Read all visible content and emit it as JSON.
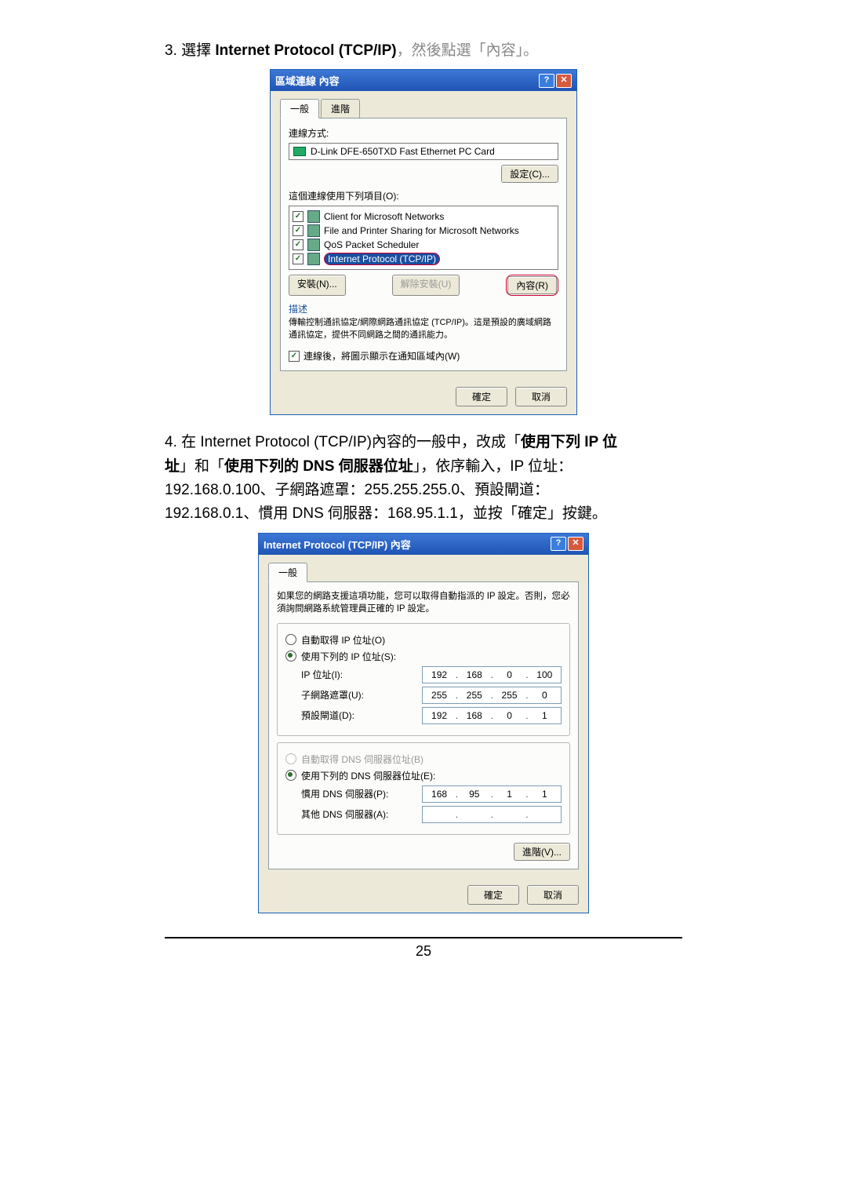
{
  "step3": {
    "prefix": "3. 選擇 ",
    "bold": "Internet Protocol (TCP/IP)",
    "suffix_gray": "，然後點選「內容」。"
  },
  "dlg1": {
    "title": "區域連線 內容",
    "tab_general": "一般",
    "tab_advanced": "進階",
    "conn_method_label": "連線方式:",
    "adapter": "D-Link DFE-650TXD Fast Ethernet PC Card",
    "configure_btn": "設定(C)...",
    "uses_items_label": "這個連線使用下列項目(O):",
    "items": [
      "Client for Microsoft Networks",
      "File and Printer Sharing for Microsoft Networks",
      "QoS Packet Scheduler",
      "Internet Protocol (TCP/IP)"
    ],
    "install_btn": "安裝(N)...",
    "uninstall_btn": "解除安裝(U)",
    "properties_btn": "內容(R)",
    "desc_title": "描述",
    "desc_text": "傳輸控制通訊協定/網際網路通訊協定 (TCP/IP)。這是預設的廣域網路通訊協定，提供不同網路之間的通訊能力。",
    "show_icon": "連線後，將圖示顯示在通知區域內(W)",
    "ok": "確定",
    "cancel": "取消"
  },
  "step4": {
    "line1_prefix": "4. 在 Internet Protocol (TCP/IP)內容的一般中，改成「",
    "line1_bold1": "使用下列 IP 位",
    "line2_bold_cont": "址",
    "line2_mid": "」和「",
    "line2_bold2": "使用下列的 DNS 伺服器位址",
    "line2_suffix": "」，依序輸入，IP 位址：",
    "line3": "192.168.0.100、子網路遮罩：255.255.255.0、預設閘道：",
    "line4": "192.168.0.1、慣用 DNS 伺服器：168.95.1.1，並按「確定」按鍵。"
  },
  "dlg2": {
    "title": "Internet Protocol (TCP/IP) 內容",
    "tab_general": "一般",
    "note": "如果您的網路支援這項功能，您可以取得自動指派的 IP 設定。否則，您必須詢問網路系統管理員正確的 IP 設定。",
    "auto_ip": "自動取得 IP 位址(O)",
    "use_ip": "使用下列的 IP 位址(S):",
    "ip_label": "IP 位址(I):",
    "ip_value": [
      "192",
      "168",
      "0",
      "100"
    ],
    "mask_label": "子網路遮罩(U):",
    "mask_value": [
      "255",
      "255",
      "255",
      "0"
    ],
    "gw_label": "預設閘道(D):",
    "gw_value": [
      "192",
      "168",
      "0",
      "1"
    ],
    "auto_dns": "自動取得 DNS 伺服器位址(B)",
    "use_dns": "使用下列的 DNS 伺服器位址(E):",
    "dns1_label": "慣用 DNS 伺服器(P):",
    "dns1_value": [
      "168",
      "95",
      "1",
      "1"
    ],
    "dns2_label": "其他 DNS 伺服器(A):",
    "dns2_value": [
      "",
      "",
      "",
      ""
    ],
    "adv_btn": "進階(V)...",
    "ok": "確定",
    "cancel": "取消"
  },
  "page_number": "25"
}
